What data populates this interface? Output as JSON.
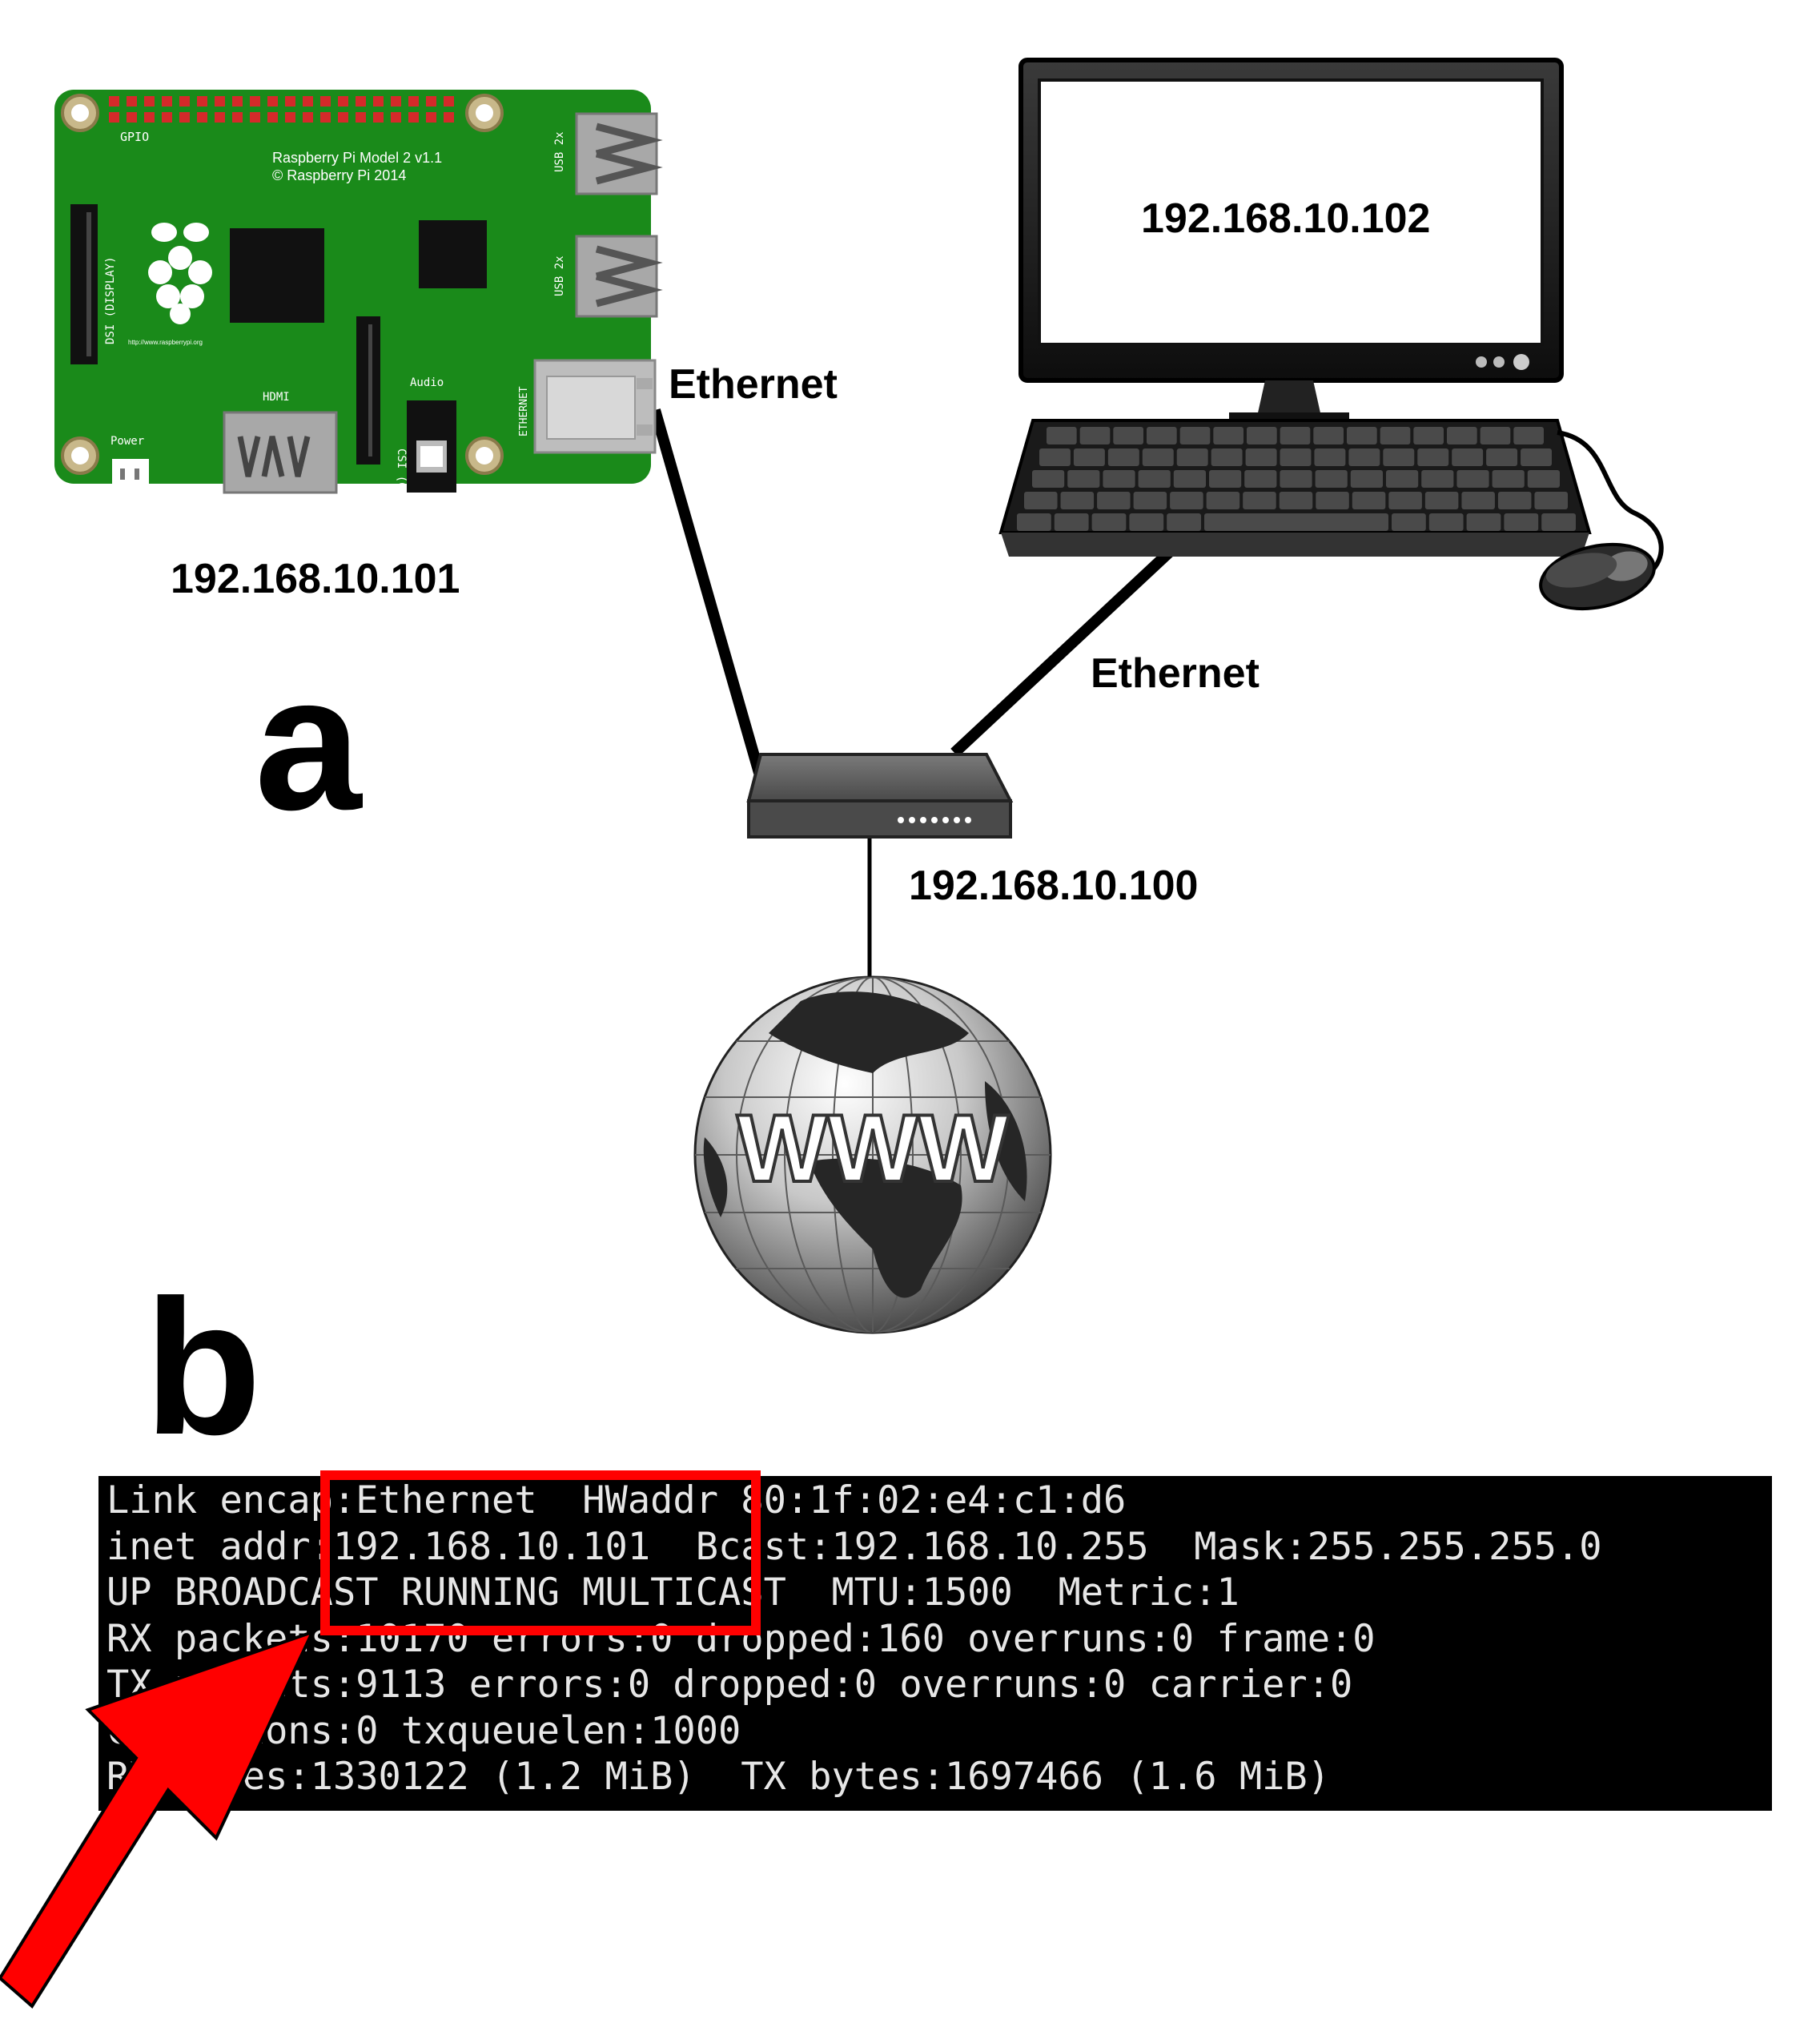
{
  "panels": {
    "a": "a",
    "b": "b"
  },
  "pi": {
    "model_line1": "Raspberry Pi Model 2 v1.1",
    "model_line2": "© Raspberry Pi 2014",
    "gpio": "GPIO",
    "dsi": "DSI (DISPLAY)",
    "csi": "CSI (CAMERA)",
    "hdmi": "HDMI",
    "power": "Power",
    "audio": "Audio",
    "usb1": "USB 2x",
    "usb2": "USB 2x",
    "ethernet_port": "ETHERNET",
    "url": "http://www.raspberrypi.org",
    "ip": "192.168.10.101",
    "board_color": "#1a8a1a"
  },
  "computer": {
    "ip": "192.168.10.102"
  },
  "router": {
    "ip": "192.168.10.100"
  },
  "links": {
    "pi_link": "Ethernet",
    "pc_link": "Ethernet"
  },
  "globe": {
    "label": "WWW"
  },
  "terminal": {
    "lines": [
      "Link encap:Ethernet  HWaddr 80:1f:02:e4:c1:d6",
      "inet addr:192.168.10.101  Bcast:192.168.10.255  Mask:255.255.255.0",
      "UP BROADCAST RUNNING MULTICAST  MTU:1500  Metric:1",
      "RX packets:10170 errors:0 dropped:160 overruns:0 frame:0",
      "TX packets:9113 errors:0 dropped:0 overruns:0 carrier:0",
      "collisions:0 txqueuelen:1000",
      "RX bytes:1330122 (1.2 MiB)  TX bytes:1697466 (1.6 MiB)"
    ],
    "highlight_color": "#ff0000"
  }
}
